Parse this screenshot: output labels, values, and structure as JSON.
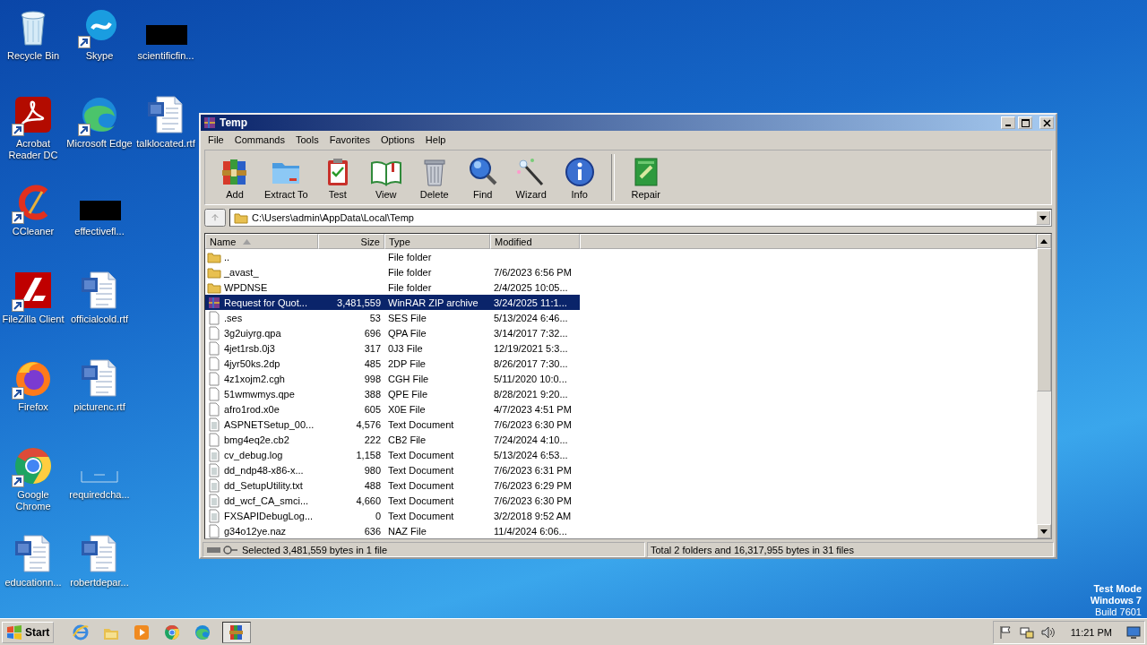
{
  "desktop": {
    "icons": [
      {
        "label": "Recycle Bin",
        "kind": "recycle",
        "shortcut": false
      },
      {
        "label": "Acrobat Reader DC",
        "kind": "acrobat",
        "shortcut": true
      },
      {
        "label": "CCleaner",
        "kind": "ccleaner",
        "shortcut": true
      },
      {
        "label": "FileZilla Client",
        "kind": "filezilla",
        "shortcut": true
      },
      {
        "label": "Firefox",
        "kind": "firefox",
        "shortcut": true
      },
      {
        "label": "Google Chrome",
        "kind": "chrome",
        "shortcut": true
      },
      {
        "label": "educationn...",
        "kind": "word",
        "shortcut": false
      },
      {
        "label": "Skype",
        "kind": "skype",
        "shortcut": true
      },
      {
        "label": "Microsoft Edge",
        "kind": "edge",
        "shortcut": true
      },
      {
        "label": "effectivefl...",
        "kind": "redacted",
        "shortcut": false
      },
      {
        "label": "officialcold.rtf",
        "kind": "word",
        "shortcut": false
      },
      {
        "label": "picturenc.rtf",
        "kind": "word",
        "shortcut": false
      },
      {
        "label": "requiredcha...",
        "kind": "blank",
        "shortcut": false
      },
      {
        "label": "robertdepar...",
        "kind": "word",
        "shortcut": false
      },
      {
        "label": "scientificfin...",
        "kind": "redacted",
        "shortcut": false
      },
      {
        "label": "talklocated.rtf",
        "kind": "word",
        "shortcut": false
      }
    ],
    "os_notice": [
      "Test Mode",
      "Windows 7",
      "Build 7601"
    ]
  },
  "window": {
    "title": "Temp",
    "menu": [
      "File",
      "Commands",
      "Tools",
      "Favorites",
      "Options",
      "Help"
    ],
    "toolbar": [
      [
        {
          "label": "Add",
          "kind": "add"
        },
        {
          "label": "Extract To",
          "kind": "extract"
        },
        {
          "label": "Test",
          "kind": "test"
        },
        {
          "label": "View",
          "kind": "view"
        },
        {
          "label": "Delete",
          "kind": "delete"
        },
        {
          "label": "Find",
          "kind": "find"
        },
        {
          "label": "Wizard",
          "kind": "wizard"
        },
        {
          "label": "Info",
          "kind": "info"
        }
      ],
      [
        {
          "label": "Repair",
          "kind": "repair"
        }
      ]
    ],
    "address": "C:\\Users\\admin\\AppData\\Local\\Temp",
    "columns": [
      {
        "label": "Name",
        "sorted": true
      },
      {
        "label": "Size",
        "sorted": false
      },
      {
        "label": "Type",
        "sorted": false
      },
      {
        "label": "Modified",
        "sorted": false
      }
    ],
    "files": [
      {
        "name": "..",
        "type": "File folder",
        "kind": "folder",
        "selected": false
      },
      {
        "name": "_avast_",
        "type": "File folder",
        "modified": "7/6/2023 6:56 PM",
        "kind": "folder",
        "selected": false
      },
      {
        "name": "WPDNSE",
        "type": "File folder",
        "modified": "2/4/2025 10:05...",
        "kind": "folder",
        "selected": false
      },
      {
        "name": "Request for Quot...",
        "size": "3,481,559",
        "type": "WinRAR ZIP archive",
        "modified": "3/24/2025 11:1...",
        "kind": "archive",
        "selected": true
      },
      {
        "name": ".ses",
        "size": "53",
        "type": "SES File",
        "modified": "5/13/2024 6:46...",
        "kind": "file",
        "selected": false
      },
      {
        "name": "3g2uiyrg.qpa",
        "size": "696",
        "type": "QPA File",
        "modified": "3/14/2017 7:32...",
        "kind": "file",
        "selected": false
      },
      {
        "name": "4jet1rsb.0j3",
        "size": "317",
        "type": "0J3 File",
        "modified": "12/19/2021 5:3...",
        "kind": "file",
        "selected": false
      },
      {
        "name": "4jyr50ks.2dp",
        "size": "485",
        "type": "2DP File",
        "modified": "8/26/2017 7:30...",
        "kind": "file",
        "selected": false
      },
      {
        "name": "4z1xojm2.cgh",
        "size": "998",
        "type": "CGH File",
        "modified": "5/11/2020 10:0...",
        "kind": "file",
        "selected": false
      },
      {
        "name": "51wmwmys.qpe",
        "size": "388",
        "type": "QPE File",
        "modified": "8/28/2021 9:20...",
        "kind": "file",
        "selected": false
      },
      {
        "name": "afro1rod.x0e",
        "size": "605",
        "type": "X0E File",
        "modified": "4/7/2023 4:51 PM",
        "kind": "file",
        "selected": false
      },
      {
        "name": "ASPNETSetup_00...",
        "size": "4,576",
        "type": "Text Document",
        "modified": "7/6/2023 6:30 PM",
        "kind": "text",
        "selected": false
      },
      {
        "name": "bmg4eq2e.cb2",
        "size": "222",
        "type": "CB2 File",
        "modified": "7/24/2024 4:10...",
        "kind": "file",
        "selected": false
      },
      {
        "name": "cv_debug.log",
        "size": "1,158",
        "type": "Text Document",
        "modified": "5/13/2024 6:53...",
        "kind": "text",
        "selected": false
      },
      {
        "name": "dd_ndp48-x86-x...",
        "size": "980",
        "type": "Text Document",
        "modified": "7/6/2023 6:31 PM",
        "kind": "text",
        "selected": false
      },
      {
        "name": "dd_SetupUtility.txt",
        "size": "488",
        "type": "Text Document",
        "modified": "7/6/2023 6:29 PM",
        "kind": "text",
        "selected": false
      },
      {
        "name": "dd_wcf_CA_smci...",
        "size": "4,660",
        "type": "Text Document",
        "modified": "7/6/2023 6:30 PM",
        "kind": "text",
        "selected": false
      },
      {
        "name": "FXSAPIDebugLog...",
        "size": "0",
        "type": "Text Document",
        "modified": "3/2/2018 9:52 AM",
        "kind": "text",
        "selected": false
      },
      {
        "name": "g34o12ye.naz",
        "size": "636",
        "type": "NAZ File",
        "modified": "11/4/2024 6:06...",
        "kind": "file",
        "selected": false
      }
    ],
    "status_left": "Selected 3,481,559 bytes in 1 file",
    "status_right": "Total 2 folders and 16,317,955 bytes in 31 files"
  },
  "taskbar": {
    "start": "Start",
    "apps": [
      {
        "kind": "ie",
        "active": false
      },
      {
        "kind": "explorer",
        "active": false
      },
      {
        "kind": "media",
        "active": false
      },
      {
        "kind": "chrome",
        "active": false
      },
      {
        "kind": "edge",
        "active": false
      },
      {
        "kind": "winrar",
        "active": true
      }
    ],
    "tray": [
      {
        "kind": "flag"
      },
      {
        "kind": "network"
      },
      {
        "kind": "volume"
      }
    ],
    "clock": "11:21 PM"
  }
}
